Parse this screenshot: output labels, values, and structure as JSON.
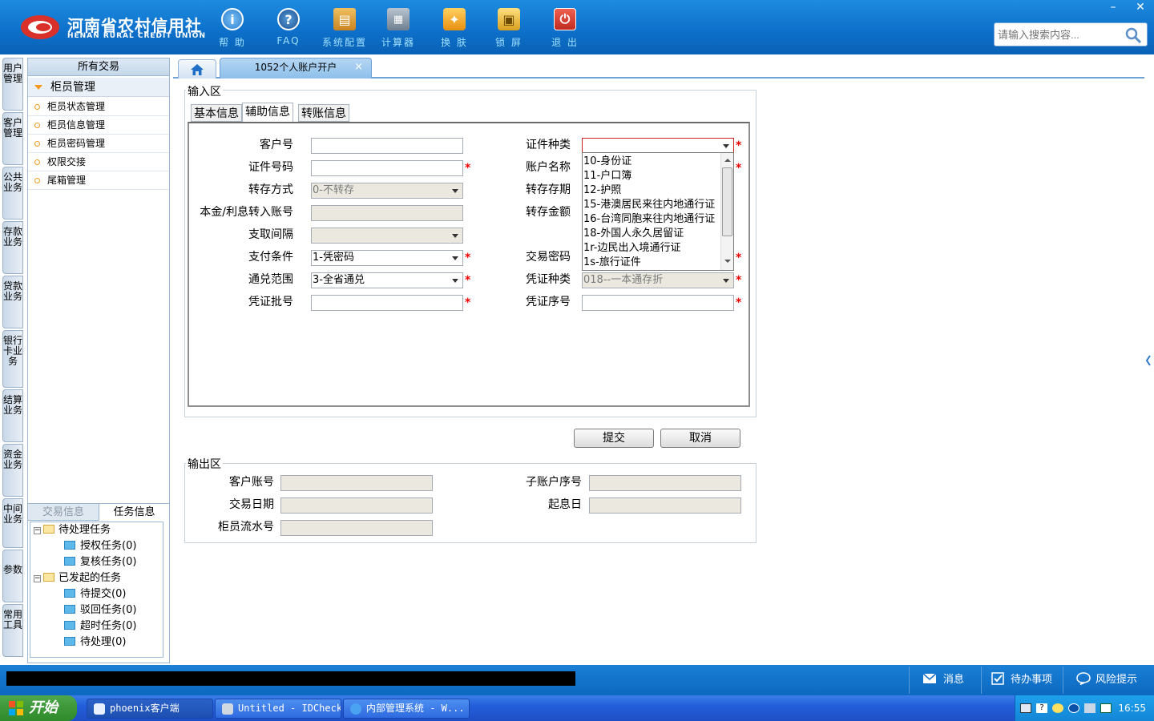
{
  "header": {
    "logo_cn": "河南省农村信用社",
    "logo_en": "HENAN RURAL CREDIT UNION",
    "toolbar": [
      {
        "label": "帮 助",
        "icon": "help-icon",
        "color": "#4a9be0"
      },
      {
        "label": "FAQ",
        "icon": "faq-icon",
        "color": "#2c6fae"
      },
      {
        "label": "系统配置",
        "icon": "toolbox-icon",
        "color": "#e0a030"
      },
      {
        "label": "计算器",
        "icon": "calculator-icon",
        "color": "#6f7f8f"
      },
      {
        "label": "换 肤",
        "icon": "shirt-icon",
        "color": "#e6a020"
      },
      {
        "label": "锁 屏",
        "icon": "lock-icon",
        "color": "#e8b838"
      },
      {
        "label": "退 出",
        "icon": "power-icon",
        "color": "#d63a2e"
      }
    ],
    "window_min": "–",
    "window_close": "✕",
    "search_placeholder": "请输入搜索内容..."
  },
  "vertical_tabs": [
    "用户管理",
    "客户管理",
    "公共业务",
    "存款业务",
    "贷款业务",
    "银行卡业务",
    "结算业务",
    "资金业务",
    "中间业务",
    "参数",
    "常用工具"
  ],
  "left_panel": {
    "header": "所有交易",
    "group": "柜员管理",
    "items": [
      "柜员状态管理",
      "柜员信息管理",
      "柜员密码管理",
      "权限交接",
      "尾箱管理"
    ],
    "bottom_tabs": [
      "交易信息",
      "任务信息"
    ],
    "tree": {
      "pending": "待处理任务",
      "pending_children": [
        "授权任务(0)",
        "复核任务(0)"
      ],
      "initiated": "已发起的任务",
      "initiated_children": [
        "待提交(0)",
        "驳回任务(0)",
        "超时任务(0)",
        "待处理(0)"
      ]
    }
  },
  "content": {
    "active_tab": "1052个人账户开户",
    "tab_close": "×",
    "input_area_title": "输入区",
    "sub_tabs": [
      "基本信息",
      "辅助信息",
      "转账信息"
    ],
    "active_sub_tab": 1,
    "form": {
      "customer_no": {
        "label": "客户号",
        "value": ""
      },
      "id_type": {
        "label": "证件种类",
        "value": ""
      },
      "id_no": {
        "label": "证件号码",
        "value": ""
      },
      "account_name": {
        "label": "账户名称",
        "value": ""
      },
      "transfer_mode": {
        "label": "转存方式",
        "value": "0-不转存"
      },
      "transfer_term": {
        "label": "转存存期",
        "value": ""
      },
      "principal_account": {
        "label": "本金/利息转入账号",
        "value": ""
      },
      "transfer_amount": {
        "label": "转存金额",
        "value": ""
      },
      "withdraw_interval": {
        "label": "支取间隔",
        "value": ""
      },
      "pay_condition": {
        "label": "支付条件",
        "value": "1-凭密码"
      },
      "trade_password": {
        "label": "交易密码",
        "value": ""
      },
      "exchange_scope": {
        "label": "通兑范围",
        "value": "3-全省通兑"
      },
      "voucher_type": {
        "label": "凭证种类",
        "value": "018--一本通存折"
      },
      "voucher_batch": {
        "label": "凭证批号",
        "value": ""
      },
      "voucher_seq": {
        "label": "凭证序号",
        "value": ""
      },
      "required_mark": "*"
    },
    "id_type_options": [
      "10-身份证",
      "11-户口簿",
      "12-护照",
      "15-港澳居民来往内地通行证",
      "16-台湾同胞来往内地通行证",
      "18-外国人永久居留证",
      "1r-边民出入境通行证",
      "1s-旅行证件"
    ],
    "buttons": {
      "submit": "提交",
      "cancel": "取消"
    },
    "output_area_title": "输出区",
    "output": {
      "customer_account": {
        "label": "客户账号",
        "value": ""
      },
      "sub_account_seq": {
        "label": "子账户序号",
        "value": ""
      },
      "trade_date": {
        "label": "交易日期",
        "value": ""
      },
      "value_date": {
        "label": "起息日",
        "value": ""
      },
      "teller_serial": {
        "label": "柜员流水号",
        "value": ""
      }
    }
  },
  "statusbar": {
    "messages": "消息",
    "todo": "待办事项",
    "risk": "风险提示"
  },
  "taskbar": {
    "start": "开始",
    "tasks": [
      "phoenix客户端",
      "Untitled - IDCheck",
      "内部管理系统 - W..."
    ],
    "clock": "16:55"
  },
  "colors": {
    "header_blue": "#0d6fc9",
    "required": "#e00000",
    "accent_orange": "#f29b1e"
  }
}
